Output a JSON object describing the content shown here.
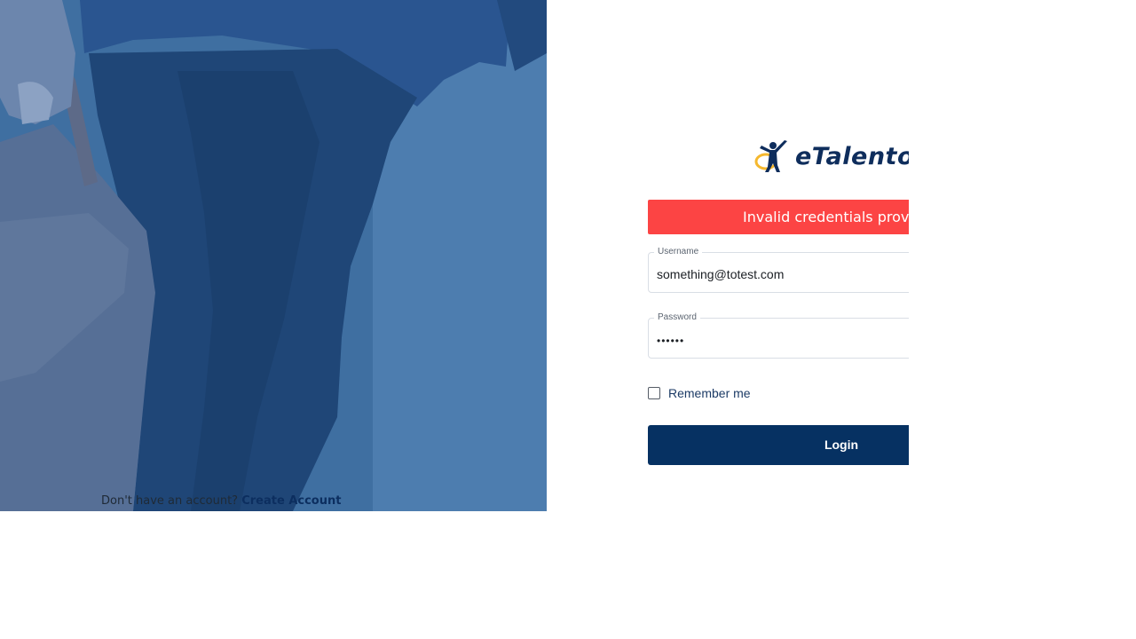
{
  "brand": {
    "name": "eTalento",
    "primary_color": "#063162",
    "accent_color": "#f5b82e",
    "hero_tint": "#2c5a8e"
  },
  "alert": {
    "message": "Invalid credentials provided",
    "color": "#fc4444"
  },
  "form": {
    "username": {
      "label": "Username",
      "value": "something@totest.com"
    },
    "password": {
      "label": "Password",
      "value": "••••••"
    },
    "remember": {
      "label": "Remember me",
      "checked": false
    },
    "login_button": "Login"
  },
  "signup": {
    "prompt": "Don't have an account?",
    "link": "Create Account"
  },
  "icons": {
    "logo": "person-with-raised-arms-icon",
    "checkbox": "checkbox-unchecked-icon"
  }
}
